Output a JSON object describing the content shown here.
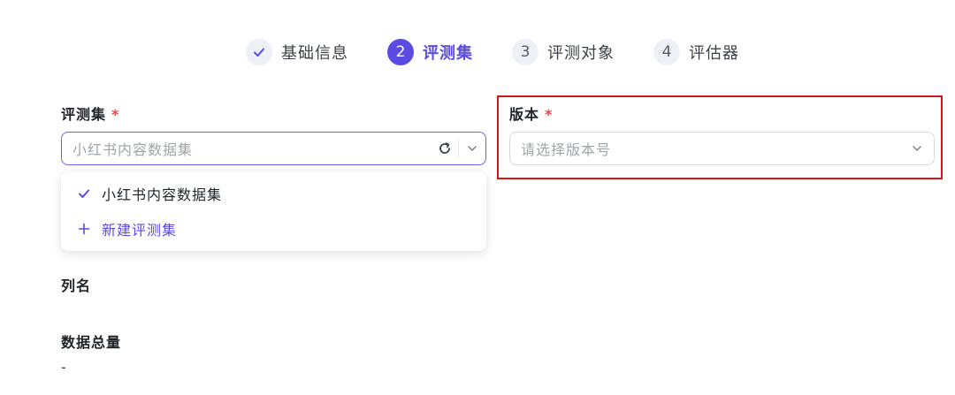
{
  "steps": [
    {
      "marker": "✓",
      "label": "基础信息",
      "state": "done"
    },
    {
      "marker": "2",
      "label": "评测集",
      "state": "active"
    },
    {
      "marker": "3",
      "label": "评测对象",
      "state": "pending"
    },
    {
      "marker": "4",
      "label": "评估器",
      "state": "pending"
    }
  ],
  "dataset_field": {
    "label": "评测集",
    "required_mark": "*",
    "placeholder": "小红书内容数据集",
    "refresh_icon": "refresh-icon",
    "dropdown_icon": "chevron-down-icon"
  },
  "version_field": {
    "label": "版本",
    "required_mark": "*",
    "placeholder": "请选择版本号",
    "dropdown_icon": "chevron-down-icon"
  },
  "dropdown": {
    "items": [
      {
        "label": "小红书内容数据集",
        "icon": "check-icon",
        "selected": true
      },
      {
        "label": "新建评测集",
        "icon": "plus-icon",
        "selected": false
      }
    ]
  },
  "columns": {
    "label": "列名"
  },
  "total": {
    "label": "数据总量",
    "value": "-"
  },
  "colors": {
    "accent": "#5b4be0",
    "required": "#e5484d",
    "highlight": "#d0181a"
  }
}
